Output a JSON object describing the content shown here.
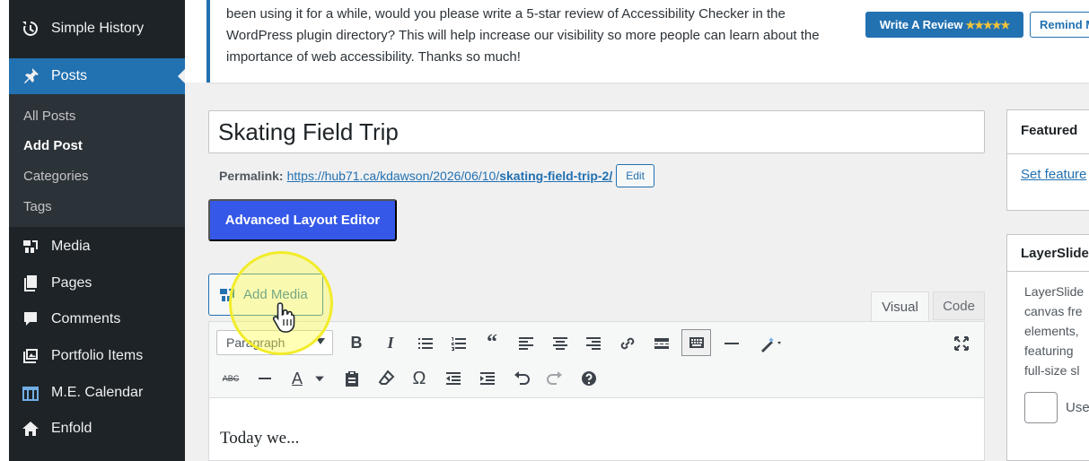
{
  "sidebar": {
    "items": [
      {
        "label": "Simple History",
        "icon": "history-icon"
      },
      {
        "label": "Posts",
        "icon": "pin-icon",
        "active": true
      },
      {
        "label": "Media",
        "icon": "media-icon"
      },
      {
        "label": "Pages",
        "icon": "pages-icon"
      },
      {
        "label": "Comments",
        "icon": "comments-icon"
      },
      {
        "label": "Portfolio Items",
        "icon": "portfolio-icon"
      },
      {
        "label": "M.E. Calendar",
        "icon": "calendar-icon"
      },
      {
        "label": "Enfold",
        "icon": "home-icon"
      }
    ],
    "submenu": [
      {
        "label": "All Posts"
      },
      {
        "label": "Add Post",
        "current": true
      },
      {
        "label": "Categories"
      },
      {
        "label": "Tags"
      }
    ]
  },
  "notice": {
    "text": "been using it for a while, would you please write a 5-star review of Accessibility Checker in the WordPress plugin directory? This will help increase our visibility so more people can learn about the importance of web accessibility. Thanks so much!",
    "write_review_label": "Write A Review",
    "write_review_stars": "★★★★★",
    "remind_label": "Remind M"
  },
  "post": {
    "title": "Skating Field Trip",
    "permalink_label": "Permalink:",
    "permalink_base": "https://hub71.ca/kdawson/2026/06/10/",
    "permalink_slug": "skating-field-trip-2/",
    "edit_label": "Edit",
    "advanced_editor_label": "Advanced Layout Editor"
  },
  "editor": {
    "add_media_label": "Add Media",
    "tab_visual": "Visual",
    "tab_code": "Code",
    "format_value": "Paragraph",
    "body_text": "Today we..."
  },
  "featured": {
    "heading": "Featured",
    "set_link": "Set feature"
  },
  "layerslider": {
    "heading": "LayerSlide",
    "desc_lines": [
      "LayerSlide",
      "canvas fre",
      "elements,",
      "featuring",
      "full-size sl"
    ],
    "checkbox_label": "Use"
  },
  "colors": {
    "sidebar_bg": "#1d2327",
    "active_blue": "#2271b1",
    "button_blue": "#3558e8",
    "highlight_yellow": "#f2ec2a"
  }
}
